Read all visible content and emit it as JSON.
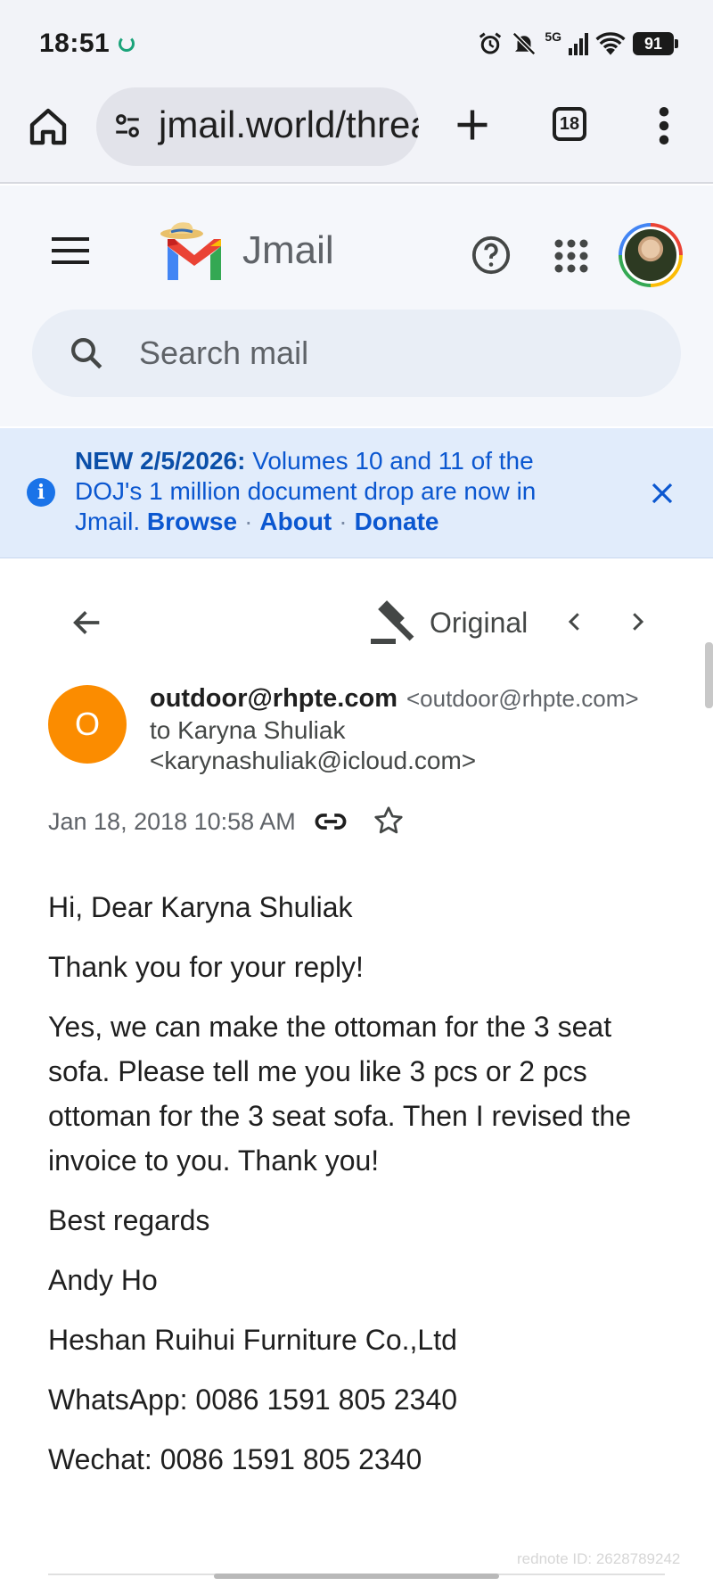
{
  "status_bar": {
    "time": "18:51",
    "network": "5G",
    "battery": "91"
  },
  "browser": {
    "url": "jmail.world/thread",
    "tab_count": "18"
  },
  "app": {
    "brand": "Jmail",
    "search_placeholder": "Search mail"
  },
  "banner": {
    "label": "NEW 2/5/2026:",
    "text": "Volumes 10 and 11 of the DOJ's 1 million document drop are now in Jmail.",
    "links": [
      "Browse",
      "About",
      "Donate"
    ]
  },
  "toolbar": {
    "original_label": "Original"
  },
  "message": {
    "avatar_letter": "O",
    "sender_name": "outdoor@rhpte.com",
    "sender_email": "<outdoor@rhpte.com>",
    "to_line": "to Karyna Shuliak",
    "to_email": "<karynashuliak@icloud.com>",
    "date": "Jan 18, 2018 10:58 AM",
    "body": [
      "Hi, Dear Karyna Shuliak",
      "Thank you for your reply!",
      "Yes, we can make the ottoman for the 3 seat sofa. Please tell me you like 3 pcs or 2 pcs ottoman for the 3 seat sofa. Then I revised the invoice to you. Thank you!",
      "Best regards",
      "Andy Ho",
      "Heshan Ruihui Furniture Co.,Ltd",
      "WhatsApp: 0086 1591 805 2340",
      "Wechat: 0086 1591 805 2340"
    ]
  },
  "watermark": "rednote ID: 2628789242",
  "colors": {
    "accent": "#0b57d0",
    "banner_bg": "#e1ecfb",
    "avatar": "#fb8c00"
  }
}
